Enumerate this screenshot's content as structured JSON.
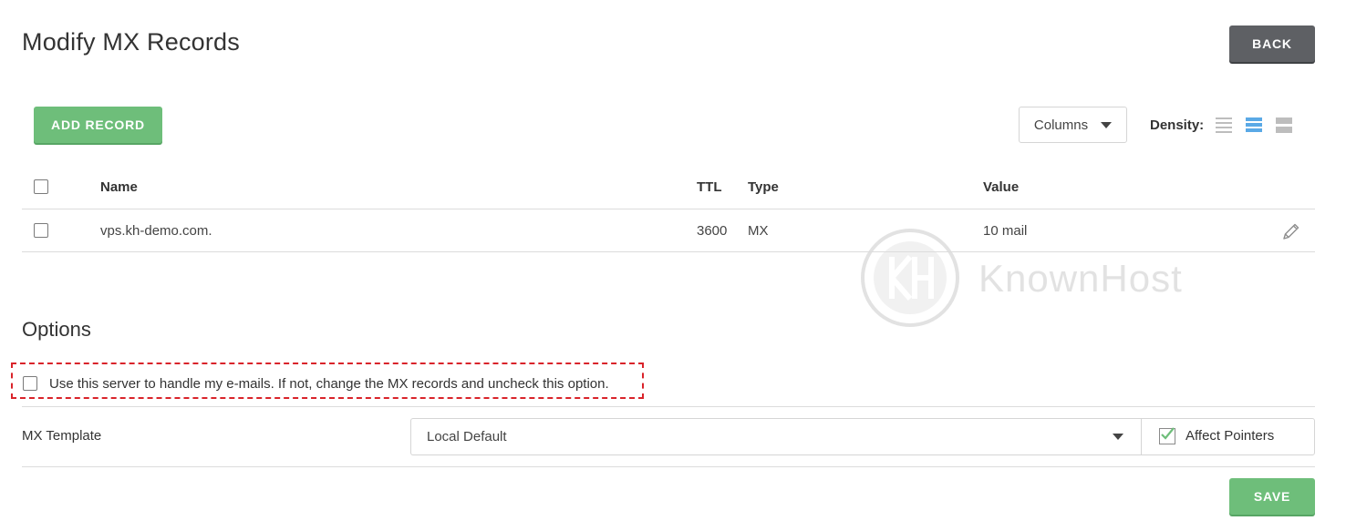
{
  "page": {
    "title": "Modify MX Records"
  },
  "header": {
    "back_label": "BACK"
  },
  "toolbar": {
    "add_record_label": "ADD RECORD",
    "columns_label": "Columns",
    "density_label": "Density:",
    "density_options": [
      "compact",
      "comfortable",
      "spacious"
    ],
    "density_selected": "comfortable"
  },
  "table": {
    "columns": [
      "Name",
      "TTL",
      "Type",
      "Value"
    ],
    "rows": [
      {
        "name": "vps.kh-demo.com.",
        "ttl": "3600",
        "type": "MX",
        "value": "10 mail"
      }
    ]
  },
  "watermark": {
    "text": "KnownHost"
  },
  "options": {
    "title": "Options",
    "use_server_label": "Use this server to handle my e-mails. If not, change the MX records and uncheck this option.",
    "use_server_checked": false,
    "mx_template_label": "MX Template",
    "mx_template_value": "Local Default",
    "affect_pointers_label": "Affect Pointers",
    "affect_pointers_checked": true
  },
  "footer": {
    "save_label": "SAVE"
  },
  "colors": {
    "accent_green": "#6ebe7a",
    "back_button": "#5e6064",
    "density_active": "#5aa9e6",
    "highlight_border": "#d9232a"
  }
}
